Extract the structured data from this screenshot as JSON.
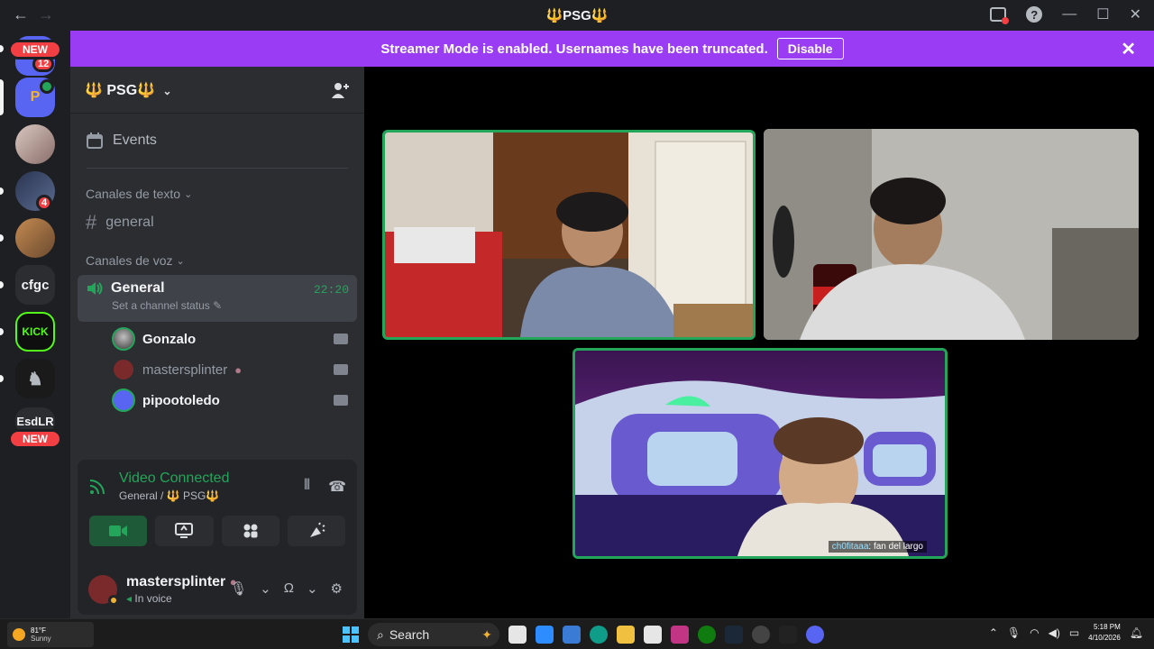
{
  "titlebar": {
    "back": "←",
    "forward": "→",
    "glyph": "🔱",
    "title": "PSG",
    "help": "?",
    "minimize": "—",
    "maximize": "☐",
    "close": "✕"
  },
  "rail": {
    "new_badge": "NEW",
    "top_count": "12",
    "dm_count": "4",
    "server_psg_label": "P",
    "server_cfgc_label": "cfgc",
    "server_kick_label": "KICK",
    "server_esdlr_label": "EsdLR"
  },
  "banner": {
    "message": "Streamer Mode is enabled. Usernames have been truncated.",
    "disable_label": "Disable",
    "close": "✕"
  },
  "sidebar": {
    "guild_glyph": "🔱",
    "guild_name": "PSG",
    "events": "Events",
    "text_category": "Canales de texto",
    "text_channel": "general",
    "voice_category": "Canales de voz",
    "voice_channel": "General",
    "voice_status": "Set a channel status",
    "voice_timer": "22:20",
    "voice_users": [
      {
        "name": "Gonzalo",
        "color": "#f2f3f5"
      },
      {
        "name": "mastersplinter",
        "color": "#949ba4"
      },
      {
        "name": "pipootoledo",
        "color": "#f2f3f5"
      }
    ]
  },
  "voice_panel": {
    "title": "Video Connected",
    "subtitle": "General / 🔱 PSG🔱"
  },
  "user": {
    "name": "mastersplinter",
    "status": "In voice"
  },
  "stage": {
    "caption_nick": "ch0fitaaa",
    "caption_text": ": fan del largo"
  },
  "taskbar": {
    "temp": "81°F",
    "condition": "Sunny",
    "search": "Search",
    "time": "5:18 PM",
    "date": "4/10/2026"
  },
  "colors": {
    "accent_green": "#23a55a",
    "banner_purple": "#9b3cf5",
    "danger_red": "#f23f43"
  }
}
